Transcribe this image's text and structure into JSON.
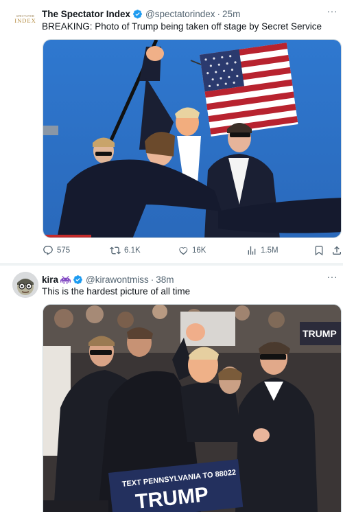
{
  "tweets": [
    {
      "avatar_text_top": "SPECTATOR",
      "avatar_text_main": "INDEX",
      "name": "The Spectator Index",
      "handle": "@spectatorindex",
      "separator": "·",
      "time": "25m",
      "text": "BREAKING: Photo of Trump being taken off stage by Secret Service",
      "more": "···",
      "stats": {
        "replies": "575",
        "retweets": "6.1K",
        "likes": "16K",
        "views": "1.5M"
      }
    },
    {
      "name": "kira",
      "handle": "@kirawontmiss",
      "separator": "·",
      "time": "38m",
      "text": "This is the hardest picture of all time",
      "more": "···",
      "image_sign_text": "TEXT PENNSYLVANIA TO 88022",
      "image_sign_big": "TRUMP",
      "image_banner": "TRUMP"
    }
  ],
  "colors": {
    "verified": "#1d9bf0",
    "secondary_text": "#536471",
    "sky": "#2a72c9",
    "suit": "#1a1f33"
  },
  "icons": [
    "verified-badge-icon",
    "reply-icon",
    "retweet-icon",
    "like-icon",
    "views-icon",
    "bookmark-icon",
    "share-icon",
    "more-icon",
    "space-invader-emoji-icon"
  ]
}
